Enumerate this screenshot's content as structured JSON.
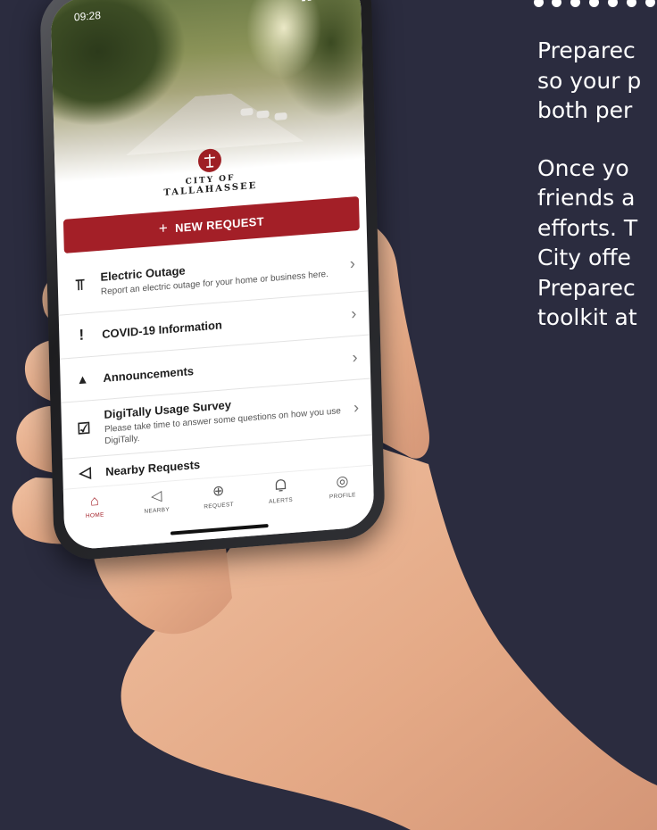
{
  "side_text": {
    "paragraph1": [
      "Preparec",
      "so your p",
      "both per"
    ],
    "paragraph2": [
      "Once yo",
      "friends a",
      "efforts. T",
      "City offe",
      "Preparec",
      "toolkit at"
    ]
  },
  "phone": {
    "status_time": "09:28",
    "status_icons": "▮▮ ◠ ▭",
    "logo": {
      "line1": "CITY OF",
      "line2": "TALLAHASSEE"
    },
    "new_request": {
      "icon": "+",
      "label": "NEW REQUEST"
    },
    "items": [
      {
        "icon": "power-pole-icon",
        "glyph": "⫪",
        "title": "Electric Outage",
        "subtitle": "Report an electric outage for your home or business here."
      },
      {
        "icon": "exclamation-icon",
        "glyph": "!",
        "title": "COVID-19 Information",
        "subtitle": ""
      },
      {
        "icon": "warning-icon",
        "glyph": "▲",
        "title": "Announcements",
        "subtitle": ""
      },
      {
        "icon": "checkbox-icon",
        "glyph": "☑",
        "title": "DigiTally Usage Survey",
        "subtitle": "Please take time to answer some questions on how you use DigiTally."
      },
      {
        "icon": "location-arrow-icon",
        "glyph": "◁",
        "title": "Nearby Requests",
        "subtitle": ""
      }
    ],
    "tabs": [
      {
        "name": "home",
        "glyph": "⌂",
        "label": "HOME",
        "active": true
      },
      {
        "name": "nearby",
        "glyph": "◁",
        "label": "NEARBY",
        "active": false
      },
      {
        "name": "request",
        "glyph": "⊕",
        "label": "REQUEST",
        "active": false
      },
      {
        "name": "alerts",
        "glyph": "♫",
        "label": "ALERTS",
        "active": false
      },
      {
        "name": "profile",
        "glyph": "◎",
        "label": "PROFILE",
        "active": false
      }
    ]
  },
  "colors": {
    "background": "#2b2c3f",
    "brand_red": "#a31f27",
    "skin": "#e9b393"
  }
}
